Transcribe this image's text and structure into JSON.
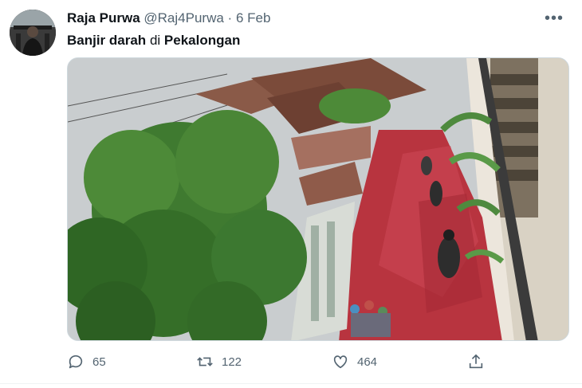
{
  "tweet": {
    "display_name": "Raja Purwa",
    "handle": "@Raj4Purwa",
    "separator": "·",
    "date": "6 Feb",
    "text_bold_1": "Banjir darah",
    "text_word": "di",
    "text_bold_2": "Pekalongan",
    "more_label": "•••"
  },
  "stats": {
    "replies": "65",
    "retweets": "122",
    "likes": "464"
  },
  "icons": {
    "avatar": "avatar-image",
    "more": "more-options-icon",
    "reply": "reply-icon",
    "retweet": "retweet-icon",
    "like": "heart-icon",
    "share": "share-icon"
  },
  "colors": {
    "text_primary": "#0f1419",
    "text_secondary": "#536471",
    "flood_red": "#b8343f"
  }
}
